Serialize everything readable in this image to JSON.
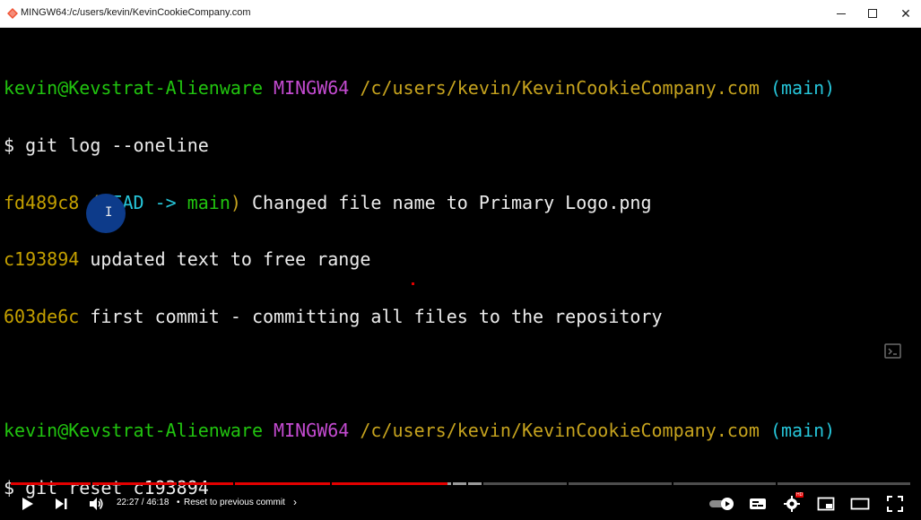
{
  "window": {
    "title": "MINGW64:/c/users/kevin/KevinCookieCompany.com"
  },
  "terminal": {
    "prompt1": {
      "user_host": "kevin@Kevstrat-Alienware",
      "env": "MINGW64",
      "path": "/c/users/kevin/KevinCookieCompany.com",
      "branch": "(main)"
    },
    "cmd1": "$ git log --oneline",
    "log": [
      {
        "hash": "fd489c8",
        "ref_open": "(",
        "ref_head": "HEAD -> ",
        "ref_main": "main",
        "ref_close": ")",
        "message": "Changed file name to Primary Logo.png"
      },
      {
        "hash": "c193894",
        "message": "updated text to free range"
      },
      {
        "hash": "603de6c",
        "message": "first commit - committing all files to the repository"
      }
    ],
    "prompt2": {
      "user_host": "kevin@Kevstrat-Alienware",
      "env": "MINGW64",
      "path": "/c/users/kevin/KevinCookieCompany.com",
      "branch": "(main)"
    },
    "cmd2": "$ git reset c193894"
  },
  "player": {
    "time_current": "22:27",
    "time_total": "46:18",
    "time_display": "22:27 / 46:18",
    "separator": "•",
    "chapter": "Reset to previous commit",
    "progress_fraction": 0.4858,
    "buffer_fraction": 0.523,
    "settings_badge": "HD",
    "colors": {
      "played": "#e40000",
      "track": "#4d4d4d",
      "buffer": "#9a9a9a"
    }
  },
  "icons": {
    "play": "play-icon",
    "next": "next-icon",
    "volume": "volume-icon",
    "autoplay": "autoplay-toggle-icon",
    "subtitles": "subtitles-icon",
    "settings": "settings-icon",
    "miniplayer": "miniplayer-icon",
    "theater": "theater-icon",
    "fullscreen": "fullscreen-icon"
  }
}
